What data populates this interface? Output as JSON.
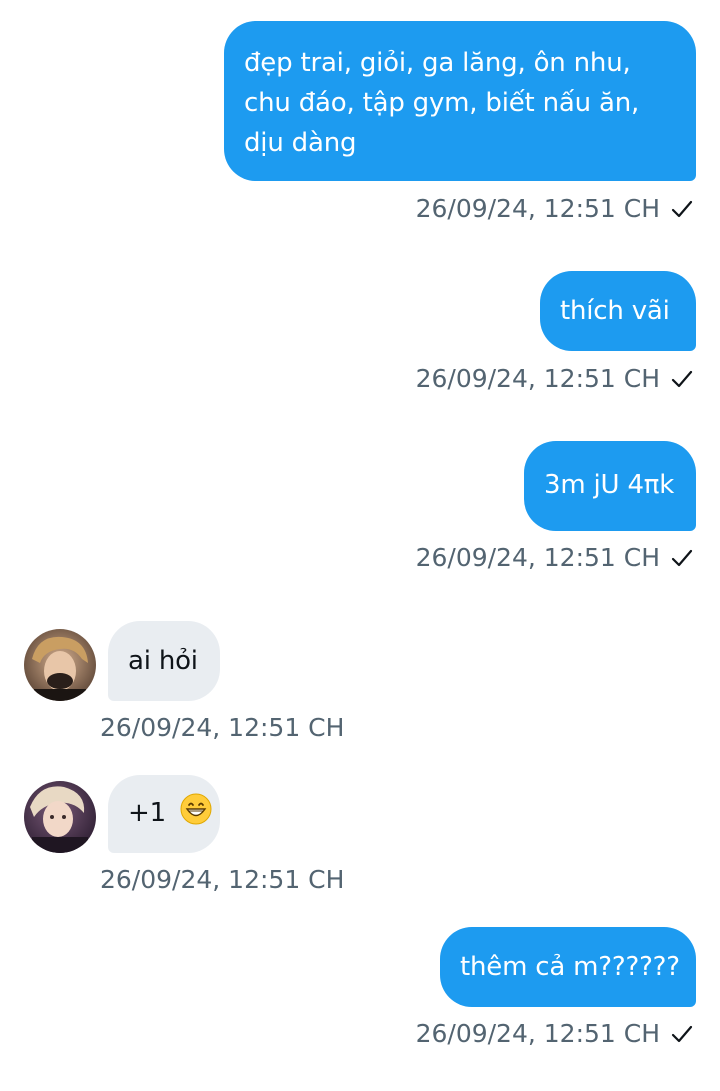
{
  "messages": [
    {
      "direction": "outgoing",
      "text": "đẹp trai, giỏi, ga lăng, ôn nhu, chu đáo, tập gym, biết nấu ăn, dịu dàng",
      "lines": [
        "đẹp trai, giỏi, ga lăng, ôn nhu,",
        "chu đáo, tập gym, biết nấu ăn,",
        "dịu dàng"
      ],
      "timestamp": "26/09/24, 12:51 CH",
      "status": "sent"
    },
    {
      "direction": "outgoing",
      "text": "thích vãi",
      "timestamp": "26/09/24, 12:51 CH",
      "status": "sent"
    },
    {
      "direction": "outgoing",
      "text": "3m jU 4πk",
      "timestamp": "26/09/24, 12:51 CH",
      "status": "sent"
    },
    {
      "direction": "incoming",
      "text": "ai hỏi",
      "timestamp": "26/09/24, 12:51 CH",
      "avatar": "user-avatar-1"
    },
    {
      "direction": "incoming",
      "text": "+1",
      "emoji": "grinning-face-emoji",
      "timestamp": "26/09/24, 12:51 CH",
      "avatar": "user-avatar-2"
    },
    {
      "direction": "outgoing",
      "text": "thêm cả m??????",
      "timestamp": "26/09/24, 12:51 CH",
      "status": "sent"
    }
  ],
  "colors": {
    "outgoing_bubble": "#1d9bf0",
    "incoming_bubble": "#e9edf1",
    "timestamp": "#536471"
  }
}
